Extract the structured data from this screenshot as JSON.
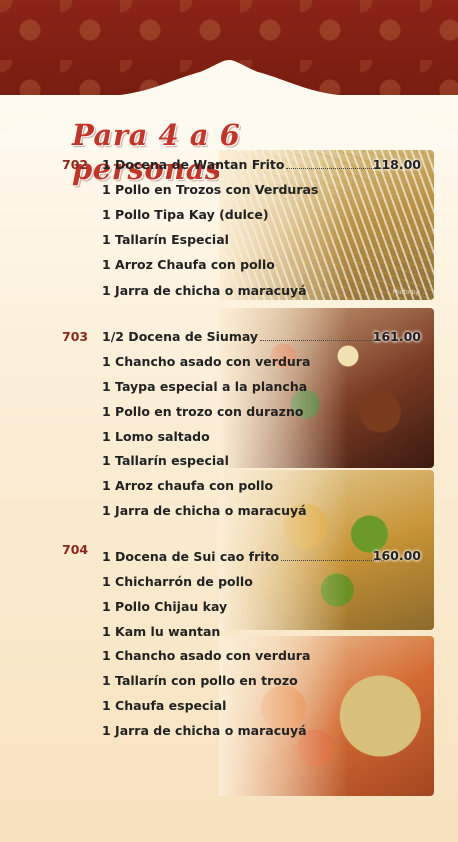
{
  "title": "Para 4 a 6 personas",
  "photo_credit": "Photo by: ...",
  "combos": [
    {
      "code": "702",
      "price": "118.00",
      "items": [
        "1 Docena de Wantan Frito",
        "1 Pollo en Trozos con Verduras",
        "1 Pollo Tipa Kay (dulce)",
        "1 Tallarín Especial",
        "1 Arroz Chaufa con pollo",
        "1 Jarra de chicha o maracuyá"
      ]
    },
    {
      "code": "703",
      "price": "161.00",
      "items": [
        "1/2 Docena de Siumay",
        "1 Chancho asado con verdura",
        "1 Taypa especial a la plancha",
        "1 Pollo en trozo con durazno",
        "1 Lomo saltado",
        "1 Tallarín especial",
        "1 Arroz chaufa con pollo",
        "1 Jarra de chicha o maracuyá"
      ]
    },
    {
      "code": "704",
      "price": "160.00",
      "items": [
        "1 Docena de Sui cao frito",
        "1 Chicharrón de pollo",
        "1 Pollo Chijau kay",
        "1 Kam lu wantan",
        "1 Chancho asado con verdura",
        "1 Tallarín con pollo en trozo",
        "1 Chaufa especial",
        "1 Jarra de chicha o maracuyá"
      ]
    }
  ]
}
